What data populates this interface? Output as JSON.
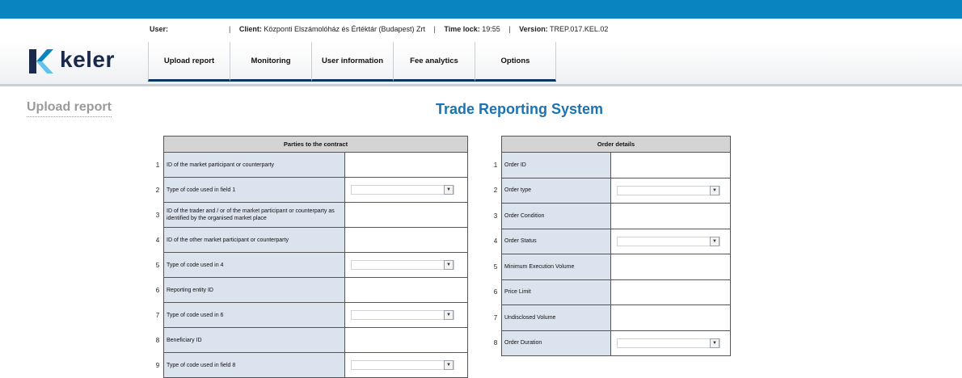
{
  "header": {
    "user_label": "User:",
    "user_value": "",
    "separator": "|",
    "client_label": "Client:",
    "client_value": "Központi Elszámolóház és Értéktár (Budapest) Zrt",
    "timelock_label": "Time lock:",
    "timelock_value": "19:55",
    "version_label": "Version:",
    "version_value": "TREP.017.KEL.02"
  },
  "brand": {
    "name": "keler",
    "accent": "#0a84c1",
    "dark": "#1b2a4a"
  },
  "nav": {
    "tabs": [
      {
        "label": "Upload report"
      },
      {
        "label": "Monitoring"
      },
      {
        "label": "User information"
      },
      {
        "label": "Fee analytics"
      },
      {
        "label": "Options"
      }
    ]
  },
  "page": {
    "title": "Upload report",
    "system_title": "Trade Reporting System"
  },
  "parties": {
    "heading": "Parties to the contract",
    "rows": [
      {
        "num": "1",
        "label": "ID of the market participant or counterparty",
        "type": "text"
      },
      {
        "num": "2",
        "label": "Type of code used in field 1",
        "type": "select"
      },
      {
        "num": "3",
        "label": "ID of the trader and / or of the market participant or counterparty as identified by the organised market place",
        "type": "text"
      },
      {
        "num": "4",
        "label": "ID of the other market participant or counterparty",
        "type": "text"
      },
      {
        "num": "5",
        "label": "Type of code used in 4",
        "type": "select"
      },
      {
        "num": "6",
        "label": "Reporting entity ID",
        "type": "text"
      },
      {
        "num": "7",
        "label": "Type of code used in 6",
        "type": "select"
      },
      {
        "num": "8",
        "label": "Beneficiary ID",
        "type": "text"
      },
      {
        "num": "9",
        "label": "Type of code used in field 8",
        "type": "select"
      }
    ]
  },
  "order": {
    "heading": "Order details",
    "rows": [
      {
        "num": "1",
        "label": "Order ID",
        "type": "text"
      },
      {
        "num": "2",
        "label": "Order type",
        "type": "select"
      },
      {
        "num": "3",
        "label": "Order Condition",
        "type": "text"
      },
      {
        "num": "4",
        "label": "Order Status",
        "type": "select"
      },
      {
        "num": "5",
        "label": "Minimum Execution Volume",
        "type": "text"
      },
      {
        "num": "6",
        "label": "Price Limit",
        "type": "text"
      },
      {
        "num": "7",
        "label": "Undisclosed Volume",
        "type": "text"
      },
      {
        "num": "8",
        "label": "Order Duration",
        "type": "select"
      }
    ]
  },
  "icons": {
    "dropdown": "chevron-down-icon"
  }
}
